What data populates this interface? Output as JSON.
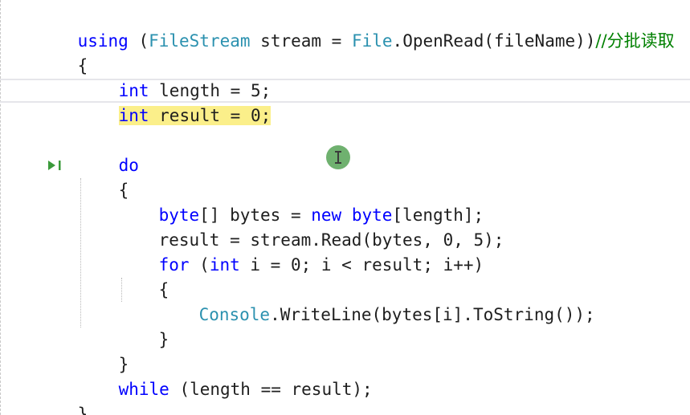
{
  "code": {
    "l1": {
      "kw1": "using",
      "p1": " (",
      "ty1": "FileStream",
      "p2": " stream = ",
      "ty2": "File",
      "p3": ".OpenRead(fileName))",
      "comment": "//分批读取"
    },
    "l2": {
      "text": "{"
    },
    "l3": {
      "kw": "int",
      "rest": " length = 5;"
    },
    "l4": {
      "kw": "int",
      "rest": " result = 0;"
    },
    "l6": {
      "kw": "do"
    },
    "l7": {
      "text": "{"
    },
    "l8": {
      "kw1": "byte",
      "p1": "[] bytes = ",
      "kw2": "new",
      "p2": " ",
      "kw3": "byte",
      "p3": "[length];"
    },
    "l9": {
      "text": "result = stream.Read(bytes, 0, 5);"
    },
    "l10": {
      "kw1": "for",
      "p1": " (",
      "kw2": "int",
      "p2": " i = 0; i < result; i++)"
    },
    "l11": {
      "text": "{"
    },
    "l12": {
      "ty": "Console",
      "rest": ".WriteLine(bytes[i].ToString());"
    },
    "l13": {
      "text": "}"
    },
    "l14": {
      "text": "}"
    },
    "l15": {
      "kw": "while",
      "rest": " (length == result);"
    },
    "l16": {
      "text": "}"
    }
  },
  "colors": {
    "keyword": "#0000ff",
    "type": "#2b91af",
    "comment": "#008000",
    "highlight": "#fbef8a",
    "step_marker": "#3a9a3a",
    "cursor_dot": "#6fb16f"
  },
  "icons": {
    "step_marker": "run-to-click-icon",
    "cursor": "text-cursor-icon"
  }
}
